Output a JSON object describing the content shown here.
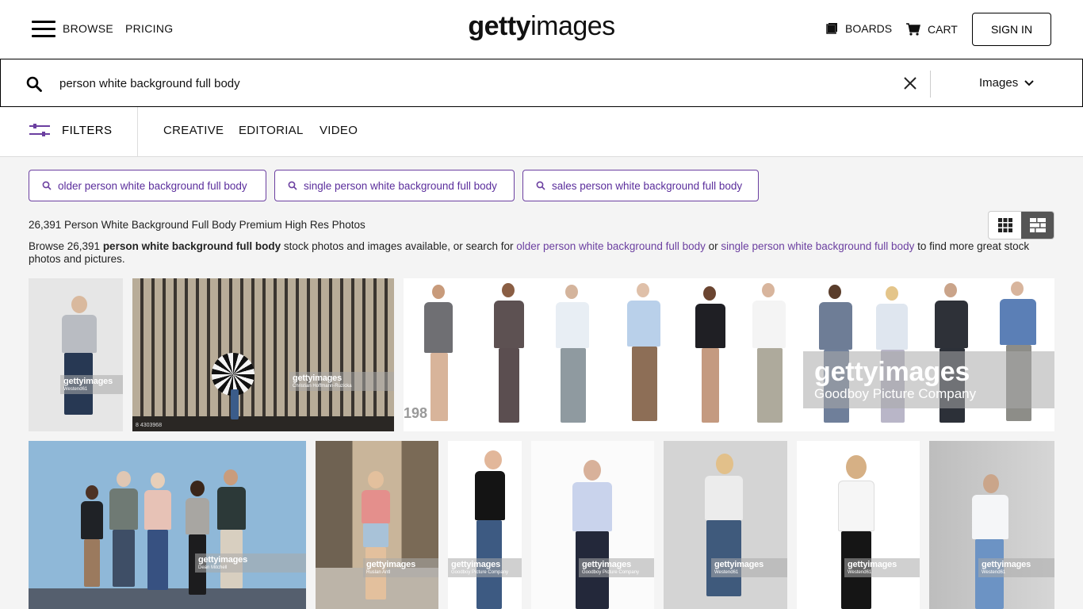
{
  "header": {
    "browse_label": "BROWSE",
    "pricing_label": "PRICING",
    "logo_bold": "getty",
    "logo_light": "images",
    "boards_label": "BOARDS",
    "cart_label": "CART",
    "signin_label": "SIGN IN"
  },
  "search": {
    "query": "person white background full body",
    "type_label": "Images"
  },
  "filterbar": {
    "filters_label": "FILTERS",
    "tabs": [
      "CREATIVE",
      "EDITORIAL",
      "VIDEO"
    ]
  },
  "suggestions": [
    "older person white background full body",
    "single person white background full body",
    "sales person white background full body"
  ],
  "results": {
    "count_title": "26,391 Person White Background Full Body Premium High Res Photos",
    "browse_prefix": "Browse 26,391 ",
    "browse_query": "person white background full body",
    "browse_mid": " stock photos and images available, or search for ",
    "browse_link1": "older person white background full body",
    "browse_or": " or ",
    "browse_link2": "single person white background full body",
    "browse_suffix": " to find more great stock photos and pictures."
  },
  "images": [
    {
      "watermark": "gettyimages",
      "credit": "Westend61"
    },
    {
      "watermark": "gettyimages",
      "credit": "Christian Hoffmann-Ruzicka",
      "badge": "8 4303968"
    },
    {
      "watermark": "gettyimages",
      "credit": "Goodboy Picture Company",
      "badge": "198"
    },
    {
      "watermark": "gettyimages",
      "credit": "Dean Mitchell"
    },
    {
      "watermark": "gettyimages",
      "credit": "Ruslan Antl"
    },
    {
      "watermark": "gettyimages",
      "credit": "Goodboy Picture Company"
    },
    {
      "watermark": "gettyimages",
      "credit": "Goodboy Picture Company"
    },
    {
      "watermark": "gettyimages",
      "credit": "Westend61"
    },
    {
      "watermark": "gettyimages",
      "credit": "Westend61"
    },
    {
      "watermark": "gettyimages",
      "credit": "Westend61"
    }
  ],
  "colors": {
    "accent": "#6b3fa0",
    "text": "#111111",
    "background": "#f4f4f4"
  }
}
